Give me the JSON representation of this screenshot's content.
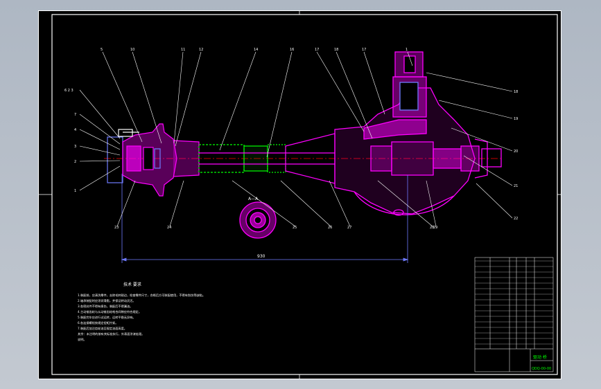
{
  "colors": {
    "background": "#b6bec8",
    "sheet": "#000000",
    "frame": "#ffffff",
    "part": "#ff00ff",
    "centerline": "#ff0000",
    "section": "#00ff00",
    "dimension": "#6f7bff",
    "leader": "#ffffff",
    "table_text": "#00ff00"
  },
  "balloons_top": [
    "5",
    "10",
    "11",
    "12",
    "14",
    "16",
    "17",
    "18",
    "17",
    "1"
  ],
  "balloons_left": [
    "6 2 3",
    "7",
    "4",
    "3",
    "2",
    "1"
  ],
  "balloons_right": [
    "18",
    "19",
    "20",
    "21",
    "22"
  ],
  "balloons_bottom": [
    "23",
    "24",
    "25",
    "26",
    "27",
    "28",
    "29"
  ],
  "view_label": "A—A",
  "dimension_text": "930",
  "notes": {
    "title": "技术 要求",
    "lines": [
      "1.装配前，应清洗零件，去除毛刺锐边，检查零件尺寸，合格后方可装配使用，不得有划伤等缺陷。",
      "2.轴承装配时应涂润滑脂，并保证转动灵活。",
      "3.各密封件不得有损伤，装配后不得漏油。",
      "4.主动锥齿轮与从动锥齿轮啮合间隙应符合规定。",
      "5.装配完毕应进行试运转，运转平稳无异响。",
      "6.各连接螺栓按规定扭矩拧紧。",
      "7.装配后加注齿轮油至规定油面高度。",
      "  其余：未注明的按有关标准执行，外表面涂漆处理。",
      "  说明。"
    ]
  },
  "title_block": {
    "name": "驱动 桥",
    "drawing_no": "QDQ-00-00"
  }
}
